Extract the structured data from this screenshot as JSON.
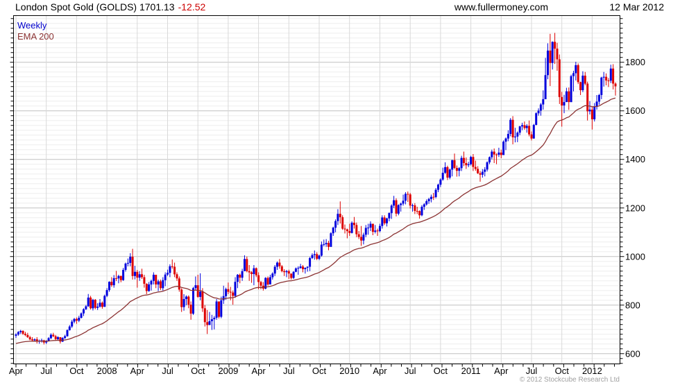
{
  "header": {
    "title_main": "London Spot Gold (GOLDS) 1701.13",
    "title_change": "-12.52",
    "website": "www.fullermoney.com",
    "date": "12 Mar 2012"
  },
  "legend": {
    "series_label": "Weekly",
    "ema_label": "EMA 200"
  },
  "footer": {
    "copyright": "© 2012 Stockcube Research Ltd"
  },
  "colors": {
    "up": "#0000dd",
    "down": "#dd0000",
    "ema": "#8b3232",
    "change_red": "#cc0000",
    "legend_blue": "#0000cc",
    "minor_grid": "#ededed",
    "major_grid": "#c0c0c0",
    "vert_grid": "#d9d9d9",
    "copyright_gray": "#a0a0a0"
  },
  "chart_data": {
    "type": "candlestick",
    "title": "London Spot Gold (GOLDS)",
    "interval": "Weekly",
    "last_price": 1701.13,
    "change": -12.52,
    "y_axis": {
      "min": 558,
      "max": 1992,
      "label_step": 200,
      "minor_step": 20,
      "labels": [
        1800,
        1600,
        1400,
        1200,
        1000,
        800,
        600
      ]
    },
    "x_axis": {
      "start": "Apr 2007",
      "end": "Mar 2012",
      "weeks_per_month": 4.3482,
      "ticks": [
        {
          "i": 0,
          "label": "Apr"
        },
        {
          "i": 13,
          "label": "Jul"
        },
        {
          "i": 26,
          "label": "Oct"
        },
        {
          "i": 39,
          "label": "2008"
        },
        {
          "i": 52,
          "label": "Apr"
        },
        {
          "i": 65,
          "label": "Jul"
        },
        {
          "i": 78,
          "label": "Oct"
        },
        {
          "i": 91,
          "label": "2009"
        },
        {
          "i": 104,
          "label": "Apr"
        },
        {
          "i": 117,
          "label": "Jul"
        },
        {
          "i": 130,
          "label": "Oct"
        },
        {
          "i": 143,
          "label": "2010"
        },
        {
          "i": 156,
          "label": "Apr"
        },
        {
          "i": 169,
          "label": "Jul"
        },
        {
          "i": 182,
          "label": "Oct"
        },
        {
          "i": 195,
          "label": "2011"
        },
        {
          "i": 208,
          "label": "Apr"
        },
        {
          "i": 221,
          "label": "Jul"
        },
        {
          "i": 234,
          "label": "Oct"
        },
        {
          "i": 247,
          "label": "2012"
        }
      ]
    },
    "ema": {
      "label": "EMA 200",
      "period_weeks": 40,
      "seed": 640
    },
    "first_open": 674,
    "weeks": [
      [
        684,
        665,
        679
      ],
      [
        693,
        674,
        689
      ],
      [
        698,
        681,
        694
      ],
      [
        696,
        677,
        682
      ],
      [
        690,
        672,
        677
      ],
      [
        686,
        665,
        668
      ],
      [
        674,
        655,
        659
      ],
      [
        668,
        652,
        655
      ],
      [
        663,
        650,
        659
      ],
      [
        668,
        642,
        650
      ],
      [
        658,
        641,
        653
      ],
      [
        662,
        646,
        655
      ],
      [
        657,
        638,
        646
      ],
      [
        656,
        640,
        652
      ],
      [
        668,
        650,
        664
      ],
      [
        684,
        660,
        678
      ],
      [
        686,
        668,
        672
      ],
      [
        677,
        655,
        660
      ],
      [
        672,
        655,
        668
      ],
      [
        668,
        642,
        650
      ],
      [
        668,
        648,
        665
      ],
      [
        678,
        660,
        672
      ],
      [
        700,
        670,
        697
      ],
      [
        718,
        695,
        712
      ],
      [
        739,
        706,
        732
      ],
      [
        747,
        725,
        743
      ],
      [
        749,
        723,
        736
      ],
      [
        756,
        730,
        748
      ],
      [
        770,
        745,
        766
      ],
      [
        787,
        755,
        783
      ],
      [
        800,
        780,
        795
      ],
      [
        846,
        793,
        831
      ],
      [
        838,
        782,
        787
      ],
      [
        826,
        778,
        822
      ],
      [
        825,
        783,
        789
      ],
      [
        808,
        780,
        794
      ],
      [
        825,
        790,
        810
      ],
      [
        815,
        785,
        793
      ],
      [
        843,
        800,
        838
      ],
      [
        870,
        833,
        862
      ],
      [
        898,
        855,
        896
      ],
      [
        915,
        875,
        882
      ],
      [
        924,
        872,
        911
      ],
      [
        941,
        899,
        910
      ],
      [
        925,
        890,
        920
      ],
      [
        922,
        894,
        903
      ],
      [
        953,
        900,
        945
      ],
      [
        975,
        938,
        971
      ],
      [
        992,
        960,
        974
      ],
      [
        1014,
        960,
        999
      ],
      [
        1032,
        905,
        920
      ],
      [
        962,
        906,
        937
      ],
      [
        945,
        872,
        913
      ],
      [
        940,
        900,
        927
      ],
      [
        950,
        908,
        915
      ],
      [
        925,
        872,
        888
      ],
      [
        890,
        845,
        858
      ],
      [
        895,
        855,
        885
      ],
      [
        905,
        860,
        900
      ],
      [
        935,
        885,
        925
      ],
      [
        910,
        870,
        885
      ],
      [
        905,
        858,
        898
      ],
      [
        905,
        862,
        870
      ],
      [
        915,
        860,
        903
      ],
      [
        935,
        878,
        926
      ],
      [
        946,
        920,
        933
      ],
      [
        968,
        915,
        960
      ],
      [
        988,
        950,
        958
      ],
      [
        975,
        915,
        927
      ],
      [
        935,
        900,
        910
      ],
      [
        918,
        855,
        864
      ],
      [
        870,
        772,
        792
      ],
      [
        845,
        777,
        825
      ],
      [
        840,
        800,
        835
      ],
      [
        840,
        787,
        802
      ],
      [
        815,
        740,
        765
      ],
      [
        875,
        760,
        870
      ],
      [
        918,
        860,
        882
      ],
      [
        925,
        830,
        834
      ],
      [
        931,
        820,
        856
      ],
      [
        870,
        772,
        787
      ],
      [
        800,
        712,
        730
      ],
      [
        780,
        681,
        718
      ],
      [
        772,
        720,
        734
      ],
      [
        760,
        698,
        742
      ],
      [
        755,
        700,
        748
      ],
      [
        825,
        740,
        815
      ],
      [
        815,
        745,
        752
      ],
      [
        835,
        746,
        820
      ],
      [
        880,
        805,
        837
      ],
      [
        872,
        822,
        866
      ],
      [
        893,
        845,
        855
      ],
      [
        875,
        820,
        852
      ],
      [
        860,
        802,
        838
      ],
      [
        915,
        830,
        896
      ],
      [
        928,
        870,
        925
      ],
      [
        930,
        890,
        913
      ],
      [
        950,
        900,
        940
      ],
      [
        1005,
        940,
        990
      ],
      [
        1000,
        935,
        940
      ],
      [
        965,
        900,
        935
      ],
      [
        940,
        892,
        928
      ],
      [
        965,
        882,
        952
      ],
      [
        955,
        915,
        923
      ],
      [
        935,
        865,
        895
      ],
      [
        900,
        865,
        880
      ],
      [
        895,
        860,
        868
      ],
      [
        915,
        865,
        912
      ],
      [
        918,
        880,
        885
      ],
      [
        925,
        895,
        915
      ],
      [
        935,
        905,
        930
      ],
      [
        965,
        920,
        958
      ],
      [
        980,
        945,
        975
      ],
      [
        990,
        950,
        960
      ],
      [
        965,
        935,
        940
      ],
      [
        948,
        920,
        936
      ],
      [
        945,
        915,
        940
      ],
      [
        946,
        908,
        930
      ],
      [
        930,
        905,
        912
      ],
      [
        940,
        908,
        937
      ],
      [
        955,
        935,
        951
      ],
      [
        960,
        925,
        953
      ],
      [
        970,
        950,
        959
      ],
      [
        965,
        935,
        948
      ],
      [
        955,
        930,
        954
      ],
      [
        960,
        938,
        958
      ],
      [
        998,
        940,
        994
      ],
      [
        1013,
        990,
        1006
      ],
      [
        1025,
        987,
        1010
      ],
      [
        1018,
        985,
        991
      ],
      [
        1008,
        985,
        1004
      ],
      [
        1062,
        1000,
        1049
      ],
      [
        1070,
        1042,
        1051
      ],
      [
        1072,
        1040,
        1056
      ],
      [
        1065,
        1026,
        1040
      ],
      [
        1100,
        1045,
        1096
      ],
      [
        1123,
        1085,
        1119
      ],
      [
        1153,
        1100,
        1146
      ],
      [
        1195,
        1130,
        1176
      ],
      [
        1227,
        1136,
        1162
      ],
      [
        1170,
        1110,
        1115
      ],
      [
        1132,
        1095,
        1112
      ],
      [
        1115,
        1075,
        1105
      ],
      [
        1135,
        1085,
        1097
      ],
      [
        1145,
        1095,
        1139
      ],
      [
        1163,
        1115,
        1130
      ],
      [
        1140,
        1080,
        1092
      ],
      [
        1105,
        1072,
        1081
      ],
      [
        1126,
        1044,
        1066
      ],
      [
        1098,
        1050,
        1090
      ],
      [
        1130,
        1080,
        1118
      ],
      [
        1135,
        1090,
        1119
      ],
      [
        1145,
        1105,
        1135
      ],
      [
        1135,
        1088,
        1102
      ],
      [
        1130,
        1095,
        1107
      ],
      [
        1115,
        1085,
        1105
      ],
      [
        1135,
        1100,
        1126
      ],
      [
        1170,
        1115,
        1161
      ],
      [
        1170,
        1130,
        1137
      ],
      [
        1160,
        1124,
        1157
      ],
      [
        1182,
        1145,
        1179
      ],
      [
        1215,
        1155,
        1210
      ],
      [
        1250,
        1200,
        1232
      ],
      [
        1240,
        1165,
        1177
      ],
      [
        1215,
        1170,
        1212
      ],
      [
        1222,
        1185,
        1218
      ],
      [
        1255,
        1210,
        1230
      ],
      [
        1265,
        1215,
        1258
      ],
      [
        1268,
        1225,
        1256
      ],
      [
        1262,
        1198,
        1210
      ],
      [
        1218,
        1185,
        1211
      ],
      [
        1220,
        1175,
        1188
      ],
      [
        1205,
        1175,
        1187
      ],
      [
        1190,
        1156,
        1170
      ],
      [
        1212,
        1166,
        1205
      ],
      [
        1220,
        1192,
        1215
      ],
      [
        1235,
        1210,
        1228
      ],
      [
        1242,
        1217,
        1237
      ],
      [
        1255,
        1223,
        1246
      ],
      [
        1262,
        1233,
        1245
      ],
      [
        1282,
        1240,
        1275
      ],
      [
        1300,
        1265,
        1296
      ],
      [
        1322,
        1286,
        1317
      ],
      [
        1366,
        1312,
        1345
      ],
      [
        1388,
        1340,
        1368
      ],
      [
        1374,
        1315,
        1325
      ],
      [
        1362,
        1318,
        1358
      ],
      [
        1398,
        1330,
        1397
      ],
      [
        1424,
        1360,
        1365
      ],
      [
        1375,
        1329,
        1353
      ],
      [
        1368,
        1330,
        1364
      ],
      [
        1415,
        1352,
        1406
      ],
      [
        1432,
        1372,
        1385
      ],
      [
        1408,
        1361,
        1376
      ],
      [
        1390,
        1368,
        1380
      ],
      [
        1415,
        1375,
        1410
      ],
      [
        1422,
        1352,
        1369
      ],
      [
        1395,
        1353,
        1361
      ],
      [
        1372,
        1340,
        1343
      ],
      [
        1352,
        1308,
        1337
      ],
      [
        1360,
        1325,
        1349
      ],
      [
        1368,
        1330,
        1358
      ],
      [
        1392,
        1350,
        1388
      ],
      [
        1412,
        1380,
        1409
      ],
      [
        1440,
        1400,
        1432
      ],
      [
        1445,
        1385,
        1420
      ],
      [
        1425,
        1380,
        1419
      ],
      [
        1448,
        1410,
        1428
      ],
      [
        1440,
        1405,
        1418
      ],
      [
        1478,
        1420,
        1473
      ],
      [
        1490,
        1438,
        1486
      ],
      [
        1520,
        1475,
        1505
      ],
      [
        1570,
        1495,
        1563
      ],
      [
        1578,
        1462,
        1491
      ],
      [
        1530,
        1470,
        1494
      ],
      [
        1515,
        1471,
        1510
      ],
      [
        1538,
        1500,
        1536
      ],
      [
        1551,
        1520,
        1541
      ],
      [
        1556,
        1522,
        1529
      ],
      [
        1545,
        1510,
        1538
      ],
      [
        1560,
        1495,
        1503
      ],
      [
        1515,
        1478,
        1486
      ],
      [
        1546,
        1485,
        1542
      ],
      [
        1594,
        1540,
        1590
      ],
      [
        1610,
        1580,
        1601
      ],
      [
        1632,
        1580,
        1626
      ],
      [
        1684,
        1605,
        1648
      ],
      [
        1818,
        1650,
        1747
      ],
      [
        1878,
        1730,
        1848
      ],
      [
        1917,
        1702,
        1797
      ],
      [
        1886,
        1770,
        1884
      ],
      [
        1921,
        1793,
        1856
      ],
      [
        1880,
        1765,
        1812
      ],
      [
        1832,
        1628,
        1657
      ],
      [
        1678,
        1535,
        1622
      ],
      [
        1666,
        1590,
        1636
      ],
      [
        1695,
        1640,
        1680
      ],
      [
        1696,
        1604,
        1636
      ],
      [
        1749,
        1640,
        1743
      ],
      [
        1765,
        1680,
        1755
      ],
      [
        1802,
        1725,
        1788
      ],
      [
        1795,
        1710,
        1718
      ],
      [
        1720,
        1665,
        1685
      ],
      [
        1763,
        1677,
        1745
      ],
      [
        1760,
        1705,
        1712
      ],
      [
        1720,
        1560,
        1598
      ],
      [
        1640,
        1585,
        1605
      ],
      [
        1615,
        1523,
        1565
      ],
      [
        1632,
        1556,
        1616
      ],
      [
        1665,
        1605,
        1638
      ],
      [
        1670,
        1625,
        1665
      ],
      [
        1740,
        1648,
        1737
      ],
      [
        1760,
        1700,
        1740
      ],
      [
        1754,
        1705,
        1725
      ],
      [
        1735,
        1698,
        1724
      ],
      [
        1790,
        1714,
        1774
      ],
      [
        1792,
        1688,
        1712
      ],
      [
        1717,
        1663,
        1701
      ]
    ]
  }
}
